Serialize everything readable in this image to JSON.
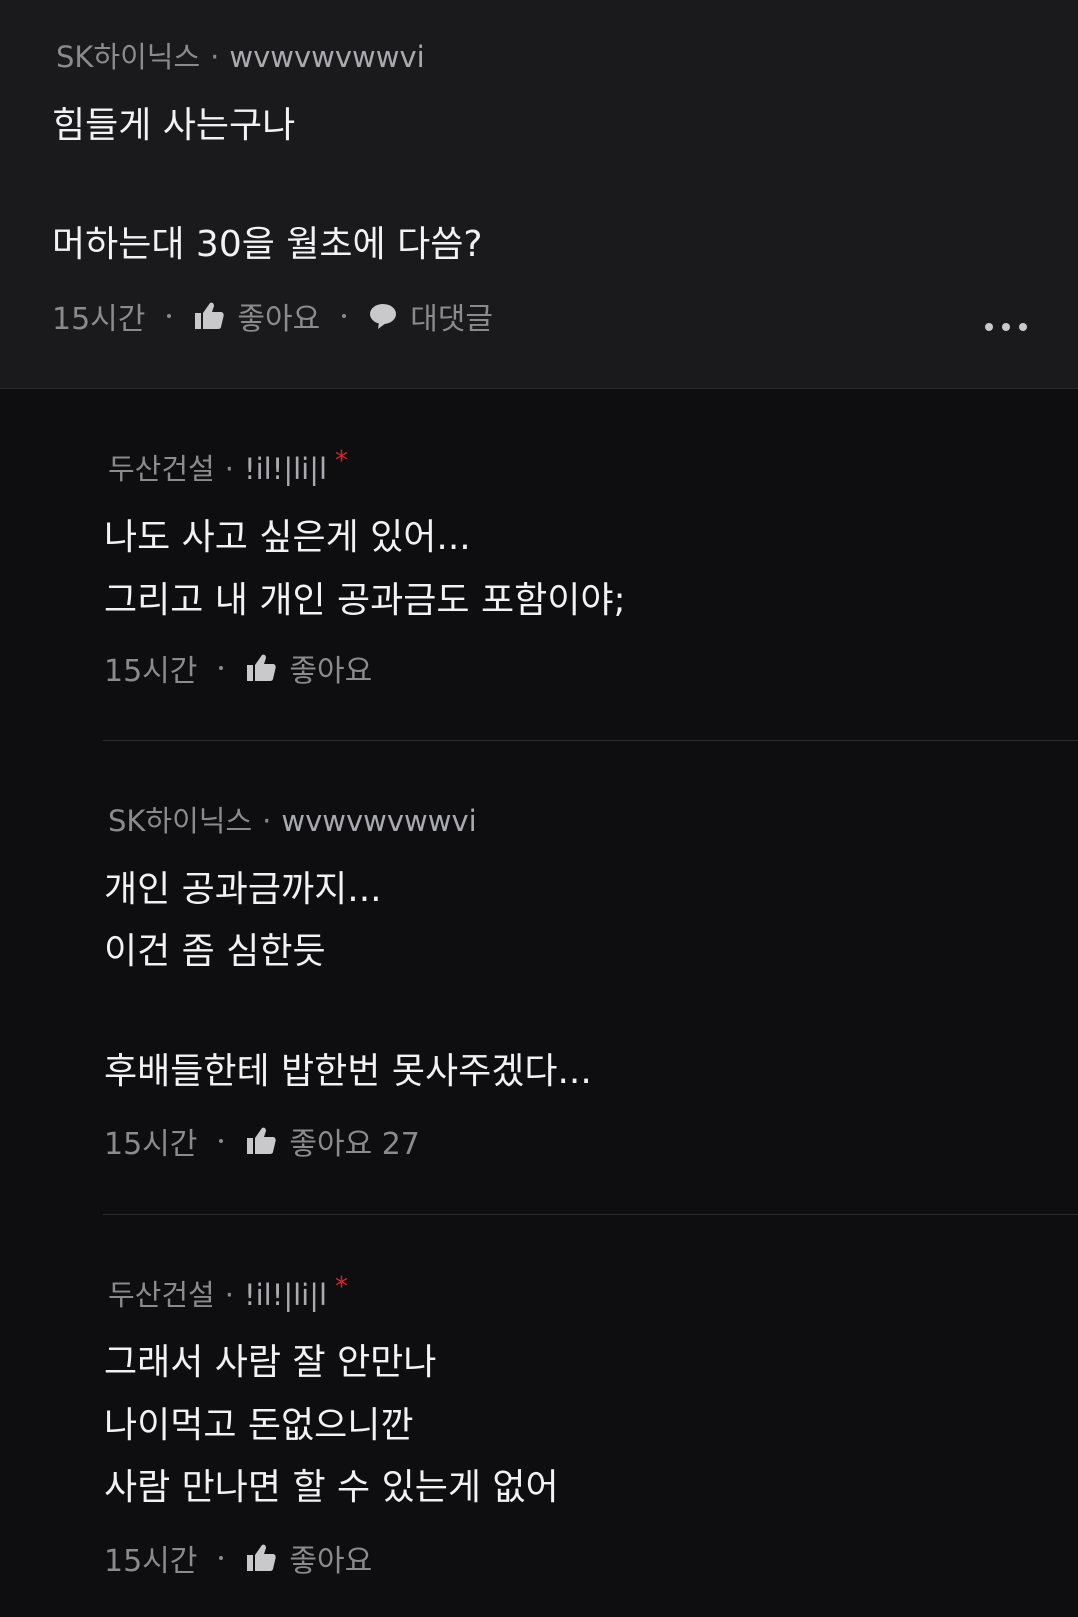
{
  "main_comment": {
    "company": "SK하이닉스",
    "user_id": "wvwvwvwwvi",
    "lines": [
      "힘들게 사는구나",
      "머하는대 30을 월초에 다씀?"
    ],
    "time": "15시간",
    "like_label": "좋아요",
    "reply_label": "대댓글"
  },
  "replies": [
    {
      "company": "두산건설",
      "user_id": "!il!|li|l",
      "author_mark": "*",
      "lines": [
        "나도 사고 싶은게 있어...",
        "그리고 내 개인 공과금도 포함이야;"
      ],
      "time": "15시간",
      "like_label": "좋아요"
    },
    {
      "company": "SK하이닉스",
      "user_id": "wvwvwvwwvi",
      "lines": [
        "개인 공과금까지...",
        "이건 좀 심한듯",
        "후배들한테 밥한번 못사주겠다..."
      ],
      "time": "15시간",
      "like_label": "좋아요 27"
    },
    {
      "company": "두산건설",
      "user_id": "!il!|li|l",
      "author_mark": "*",
      "lines": [
        "그래서 사람 잘 안만나",
        "나이먹고 돈없으니깐",
        "사람 만나면 할 수 있는게 없어"
      ],
      "time": "15시간",
      "like_label": "좋아요"
    }
  ],
  "icons": {
    "like": "thumbs-up-icon",
    "reply": "speech-bubble-icon",
    "more": "more-dots-icon"
  },
  "colors": {
    "background": "#0e0e10",
    "main_comment_bg": "#1a1a1c",
    "author_mark": "#d9232a"
  }
}
